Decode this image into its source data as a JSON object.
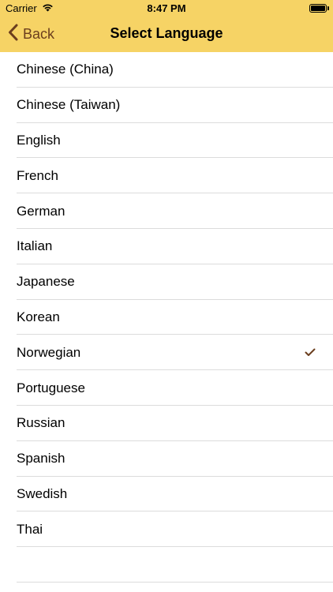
{
  "status_bar": {
    "carrier": "Carrier",
    "time": "8:47 PM"
  },
  "nav": {
    "back_label": "Back",
    "title": "Select Language",
    "accent": "#6b3e1e",
    "background": "#f6d365"
  },
  "languages": [
    {
      "label": "Chinese (China)"
    },
    {
      "label": "Chinese (Taiwan)"
    },
    {
      "label": "English"
    },
    {
      "label": "French"
    },
    {
      "label": "German"
    },
    {
      "label": "Italian"
    },
    {
      "label": "Japanese"
    },
    {
      "label": "Korean"
    },
    {
      "label": "Norwegian",
      "selected": true
    },
    {
      "label": "Portuguese"
    },
    {
      "label": "Russian"
    },
    {
      "label": "Spanish"
    },
    {
      "label": "Swedish"
    },
    {
      "label": "Thai"
    }
  ]
}
